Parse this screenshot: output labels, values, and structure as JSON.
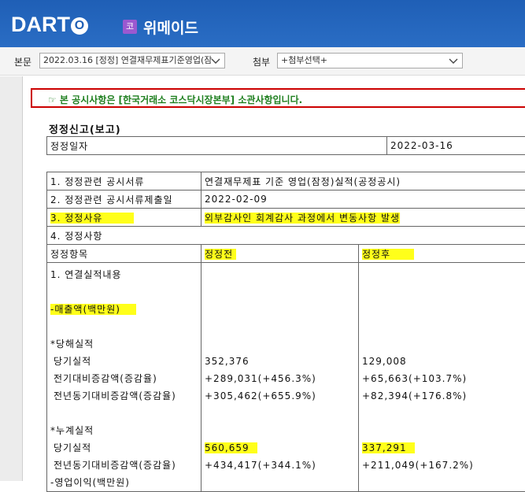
{
  "header": {
    "logo_text": "DART",
    "logo_o": "O",
    "company_badge": "코",
    "company_name": "위메이드"
  },
  "toolbar": {
    "main_label": "본문",
    "main_select_value": "2022.03.16 [정정] 연결재무제표기준영업(잠",
    "attach_label": "첨부",
    "attach_select_value": "+첨부선택+"
  },
  "notice": {
    "text": "☞ 본 공시사항은 [한국거래소 코스닥시장본부] 소관사항입니다."
  },
  "doc": {
    "title": "정정신고(보고)",
    "date_label": "정정일자",
    "date_value": "2022-03-16"
  },
  "rows": {
    "r1_label": "1. 정정관련 공시서류",
    "r1_value": "연결재무제표 기준 영업(잠정)실적(공정공시)",
    "r2_label": "2. 정정관련 공시서류제출일",
    "r2_value": "2022-02-09",
    "r3_label": "3. 정정사유",
    "r3_value": "외부감사인 회계감사 과정에서 변동사항 발생",
    "r4_label": "4. 정정사항",
    "col_item": "정정항목",
    "col_before": "정정전",
    "col_after": "정정후"
  },
  "items": {
    "section": "1. 연결실적내용",
    "revenue": "-매출액(백만원)",
    "current_header": "*당해실적",
    "current_actual": "당기실적",
    "current_qoq": "전기대비증감액(증감율)",
    "current_yoy": "전년동기대비증감액(증감율)",
    "cumulative_header": "*누계실적",
    "cum_actual": "당기실적",
    "cum_yoy": "전년동기대비증감액(증감율)",
    "next_item": "-영업이익(백만원)"
  },
  "before": {
    "current_actual": "352,376",
    "current_qoq": "+289,031(+456.3%)",
    "current_yoy": "+305,462(+655.9%)",
    "cum_actual": "560,659",
    "cum_yoy": "+434,417(+344.1%)"
  },
  "after": {
    "current_actual": "129,008",
    "current_qoq": "+65,663(+103.7%)",
    "current_yoy": "+82,394(+176.8%)",
    "cum_actual": "337,291",
    "cum_yoy": "+211,049(+167.2%)"
  },
  "colors": {
    "header_blue": "#1f5fb6",
    "notice_border": "#cc0000",
    "notice_text": "#1f7f1f",
    "highlight": "#ffff1a"
  }
}
